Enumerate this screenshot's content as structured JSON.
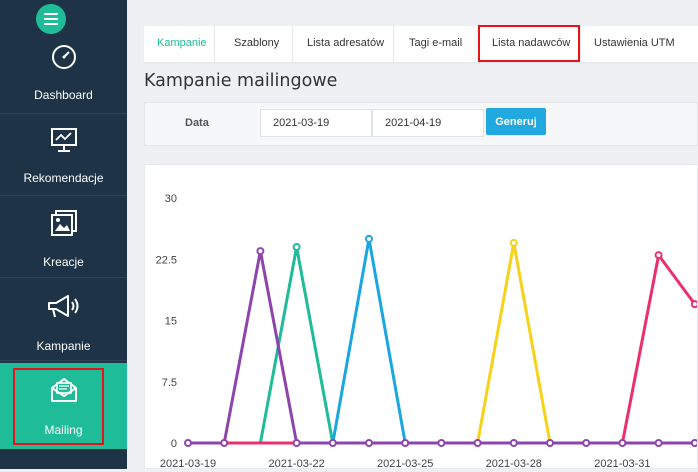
{
  "sidebar": {
    "items": [
      {
        "label": "Dashboard",
        "icon": "gauge-icon"
      },
      {
        "label": "Rekomendacje",
        "icon": "monitor-chart-icon"
      },
      {
        "label": "Kreacje",
        "icon": "images-icon"
      },
      {
        "label": "Kampanie",
        "icon": "megaphone-icon"
      },
      {
        "label": "Mailing",
        "icon": "open-envelope-icon"
      }
    ],
    "active": "Mailing",
    "menu_icon": "menu-icon",
    "accent": "#1ebc98",
    "background": "#1e3446"
  },
  "tabs": [
    {
      "label": "Kampanie",
      "active": true
    },
    {
      "label": "Szablony",
      "active": false
    },
    {
      "label": "Lista adresatów",
      "active": false
    },
    {
      "label": "Tagi e-mail",
      "active": false
    },
    {
      "label": "Lista nadawców",
      "active": false,
      "highlighted": true
    },
    {
      "label": "Ustawienia UTM",
      "active": false
    }
  ],
  "page_title": "Kampanie mailingowe",
  "filter": {
    "label": "Data",
    "date_from": "2021-03-19",
    "date_to": "2021-04-19",
    "generate_label": "Generuj",
    "button_color": "#20a8e0"
  },
  "chart_data": {
    "type": "line",
    "x": [
      "2021-03-19",
      "2021-03-20",
      "2021-03-21",
      "2021-03-22",
      "2021-03-23",
      "2021-03-24",
      "2021-03-25",
      "2021-03-26",
      "2021-03-27",
      "2021-03-28",
      "2021-03-29",
      "2021-03-30",
      "2021-03-31",
      "2021-04-01",
      "2021-04-02"
    ],
    "x_tick_labels": [
      "2021-03-19",
      "2021-03-22",
      "2021-03-25",
      "2021-03-28",
      "2021-03-31"
    ],
    "y_ticks": [
      "0",
      "7.5",
      "15",
      "22.5",
      "30"
    ],
    "ylim": [
      0,
      30
    ],
    "grid": false,
    "series": [
      {
        "color": "#8e44ad",
        "values": [
          0,
          0,
          23.5,
          0,
          0,
          0,
          0,
          0,
          0,
          0,
          0,
          0,
          0,
          0,
          0
        ]
      },
      {
        "color": "#1ebc98",
        "values": [
          0,
          0,
          0,
          24,
          0,
          0,
          0,
          0,
          0,
          0,
          0,
          0,
          0,
          0,
          0
        ]
      },
      {
        "color": "#1aa7e0",
        "values": [
          0,
          0,
          0,
          0,
          0,
          25,
          0,
          0,
          0,
          0,
          0,
          0,
          0,
          0,
          0
        ]
      },
      {
        "color": "#f7d21a",
        "values": [
          0,
          0,
          0,
          0,
          0,
          0,
          0,
          0,
          0,
          24.5,
          0,
          0,
          0,
          0,
          0
        ]
      },
      {
        "color": "#ec2f6b",
        "values": [
          0,
          0,
          0,
          0,
          0,
          0,
          0,
          0,
          0,
          0,
          0,
          0,
          0,
          23,
          17
        ]
      }
    ]
  }
}
